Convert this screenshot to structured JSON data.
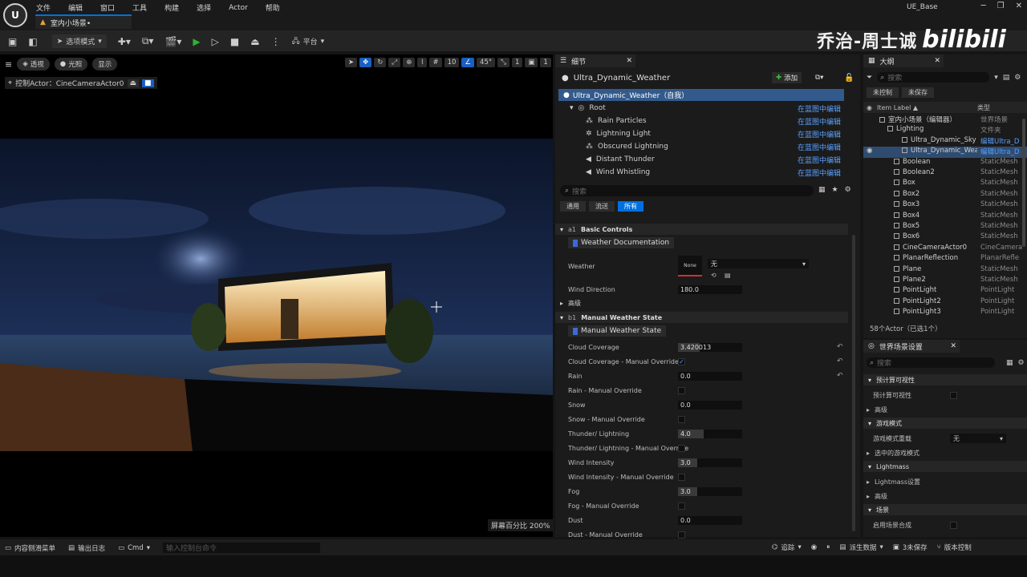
{
  "app": {
    "title": "UE_Base",
    "doc_tab": "室内小场景•"
  },
  "menu": [
    "文件",
    "编辑",
    "窗口",
    "工具",
    "构建",
    "选择",
    "Actor",
    "帮助"
  ],
  "toolbar": {
    "mode": "选项模式",
    "platform": "平台"
  },
  "viewport": {
    "buttons": [
      "透视",
      "光照",
      "显示"
    ],
    "pilot_label": "控制Actor：CineCameraActor0",
    "grid_value": "10",
    "angle_value": "45°",
    "scale_value": "1",
    "camera_speed": "1",
    "screen_percentage": "屏幕百分比  200%"
  },
  "details": {
    "tab": "细节",
    "actor_name": "Ultra_Dynamic_Weather",
    "add_label": "添加",
    "self_label": "Ultra_Dynamic_Weather（自我）",
    "components": [
      {
        "label": "Root",
        "link": "在蓝图中编辑"
      },
      {
        "label": "Rain Particles",
        "link": "在蓝图中编辑"
      },
      {
        "label": "Lightning Light",
        "link": "在蓝图中编辑"
      },
      {
        "label": "Obscured Lightning",
        "link": "在蓝图中编辑"
      },
      {
        "label": "Distant Thunder",
        "link": "在蓝图中编辑"
      },
      {
        "label": "Wind Whistling",
        "link": "在蓝图中编辑"
      }
    ],
    "search_placeholder": "搜索",
    "filters": [
      "通用",
      "流送",
      "所有"
    ],
    "section_basic": "Basic Controls",
    "section_basic_prefix": "a1",
    "doc_button": "Weather Documentation",
    "weather_label": "Weather",
    "weather_thumb": "None",
    "weather_value": "无",
    "wind_dir_label": "Wind Direction",
    "wind_dir_value": "180.0",
    "advanced": "高级",
    "section_manual": "Manual Weather State",
    "section_manual_prefix": "b1",
    "manual_button": "Manual Weather State",
    "props": [
      {
        "label": "Cloud Coverage",
        "value": "3.420013",
        "kind": "field",
        "fill": 0.34,
        "reset": true
      },
      {
        "label": "Cloud Coverage - Manual Override",
        "kind": "check",
        "checked": true,
        "reset": true
      },
      {
        "label": "Rain",
        "value": "0.0",
        "kind": "field",
        "fill": 0,
        "reset": true
      },
      {
        "label": "Rain - Manual Override",
        "kind": "check",
        "checked": false
      },
      {
        "label": "Snow",
        "value": "0.0",
        "kind": "field",
        "fill": 0
      },
      {
        "label": "Snow - Manual Override",
        "kind": "check",
        "checked": false
      },
      {
        "label": "Thunder/ Lightning",
        "value": "4.0",
        "kind": "field",
        "fill": 0.4
      },
      {
        "label": "Thunder/ Lightning - Manual Override",
        "kind": "check",
        "checked": false
      },
      {
        "label": "Wind Intensity",
        "value": "3.0",
        "kind": "field",
        "fill": 0.3
      },
      {
        "label": "Wind Intensity - Manual Override",
        "kind": "check",
        "checked": false
      },
      {
        "label": "Fog",
        "value": "3.0",
        "kind": "field",
        "fill": 0.3
      },
      {
        "label": "Fog - Manual Override",
        "kind": "check",
        "checked": false
      },
      {
        "label": "Dust",
        "value": "0.0",
        "kind": "field",
        "fill": 0
      },
      {
        "label": "Dust - Manual Override",
        "kind": "check",
        "checked": false
      }
    ]
  },
  "outliner": {
    "tab": "大纲",
    "search_placeholder": "搜索",
    "unsaved": "未控制",
    "not_saved": "未保存",
    "col_label": "Item Label ▲",
    "col_type": "类型",
    "rows": [
      {
        "name": "室内小场景（编辑器）",
        "type": "世界场景",
        "indent": 18
      },
      {
        "name": "Lighting",
        "type": "文件夹",
        "indent": 28
      },
      {
        "name": "Ultra_Dynamic_Sky",
        "type": "编辑Ultra_D",
        "indent": 46,
        "link": true
      },
      {
        "name": "Ultra_Dynamic_Weatl",
        "type": "编辑Ultra_D",
        "indent": 46,
        "link": true,
        "selected": true
      },
      {
        "name": "Boolean",
        "type": "StaticMesh",
        "indent": 36
      },
      {
        "name": "Boolean2",
        "type": "StaticMesh",
        "indent": 36
      },
      {
        "name": "Box",
        "type": "StaticMesh",
        "indent": 36
      },
      {
        "name": "Box2",
        "type": "StaticMesh",
        "indent": 36
      },
      {
        "name": "Box3",
        "type": "StaticMesh",
        "indent": 36
      },
      {
        "name": "Box4",
        "type": "StaticMesh",
        "indent": 36
      },
      {
        "name": "Box5",
        "type": "StaticMesh",
        "indent": 36
      },
      {
        "name": "Box6",
        "type": "StaticMesh",
        "indent": 36
      },
      {
        "name": "CineCameraActor0",
        "type": "CineCamera",
        "indent": 36
      },
      {
        "name": "PlanarReflection",
        "type": "PlanarRefle",
        "indent": 36
      },
      {
        "name": "Plane",
        "type": "StaticMesh",
        "indent": 36
      },
      {
        "name": "Plane2",
        "type": "StaticMesh",
        "indent": 36
      },
      {
        "name": "PointLight",
        "type": "PointLight",
        "indent": 36
      },
      {
        "name": "PointLight2",
        "type": "PointLight",
        "indent": 36
      },
      {
        "name": "PointLight3",
        "type": "PointLight",
        "indent": 36
      }
    ],
    "count": "58个Actor（已选1个）"
  },
  "world": {
    "tab": "世界场景设置",
    "search_placeholder": "搜索",
    "items": [
      {
        "kind": "sec",
        "label": "预计算可视性"
      },
      {
        "kind": "prop",
        "label": "预计算可视性",
        "check": true
      },
      {
        "kind": "sub",
        "label": "高级"
      },
      {
        "kind": "sec",
        "label": "游戏模式"
      },
      {
        "kind": "prop",
        "label": "游戏模式重载",
        "value": "无"
      },
      {
        "kind": "sub",
        "label": "选中的游戏模式"
      },
      {
        "kind": "sec",
        "label": "Lightmass"
      },
      {
        "kind": "sub",
        "label": "Lightmass设置"
      },
      {
        "kind": "sub",
        "label": "高级"
      },
      {
        "kind": "sec",
        "label": "场景"
      },
      {
        "kind": "prop",
        "label": "启用场景合成",
        "check": true
      }
    ]
  },
  "statusbar": {
    "content_drawer": "内容侧滑菜单",
    "output_log": "输出日志",
    "cmd": "Cmd",
    "cmd_placeholder": "输入控制台命令",
    "trace": "追踪",
    "derived_data": "派生数据",
    "unsaved": "3未保存",
    "source_control": "版本控制"
  },
  "watermark": {
    "text": "乔治-周士诚",
    "logo": "bilibili"
  }
}
